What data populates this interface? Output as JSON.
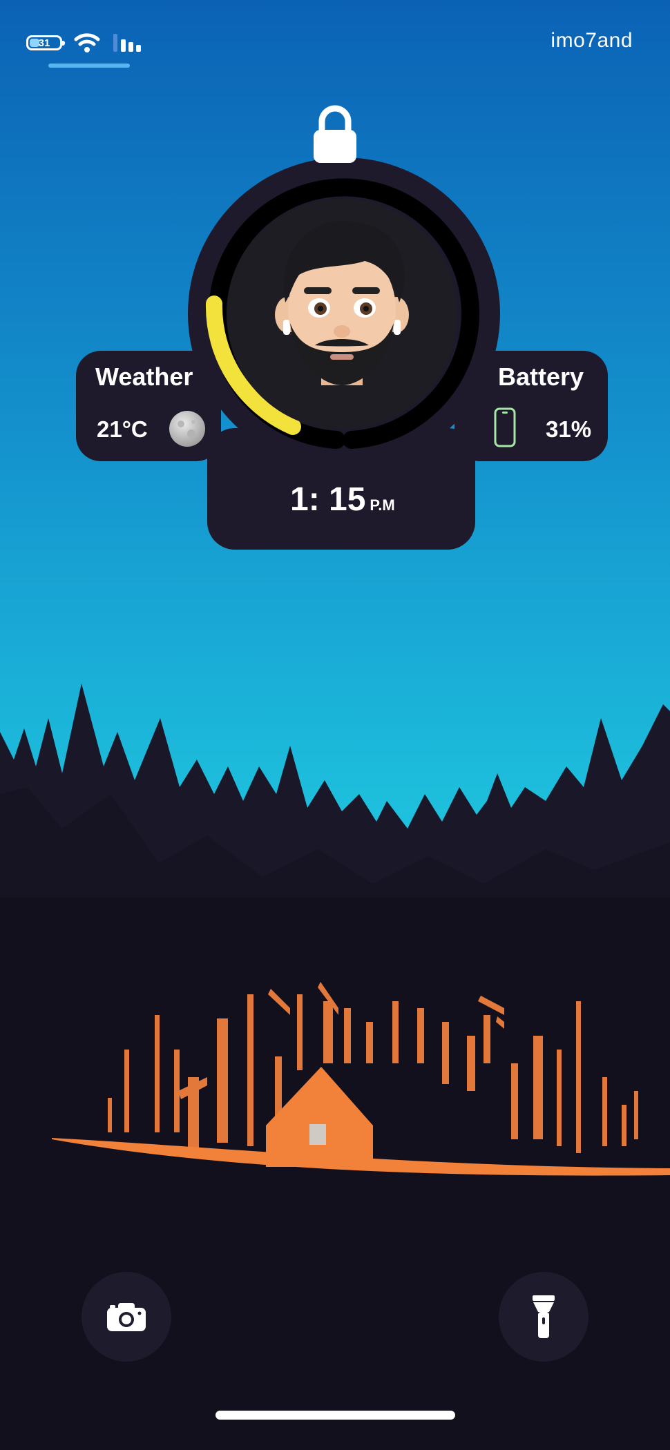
{
  "status_bar": {
    "battery_level": "31",
    "carrier": "imo7and"
  },
  "widget": {
    "weather": {
      "title": "Weather",
      "temperature": "21°C",
      "icon": "moon-icon"
    },
    "battery": {
      "title": "Battery",
      "percent": "31%",
      "icon": "phone-icon",
      "level_fraction": 0.31
    },
    "time": {
      "value": "1: 15",
      "ampm": "P.M"
    },
    "avatar": "memoji-avatar",
    "lock_icon": "lock-icon"
  },
  "bottom": {
    "camera_icon": "camera-icon",
    "flashlight_icon": "flashlight-icon"
  },
  "colors": {
    "sky_top": "#0b62b5",
    "sky_bottom": "#1bc0dd",
    "forest": "#171424",
    "widget_bg": "#1e1a2c",
    "ring_accent": "#f2e23b",
    "cabin_orange": "#f2823a",
    "battery_green": "#a8e6a8"
  }
}
